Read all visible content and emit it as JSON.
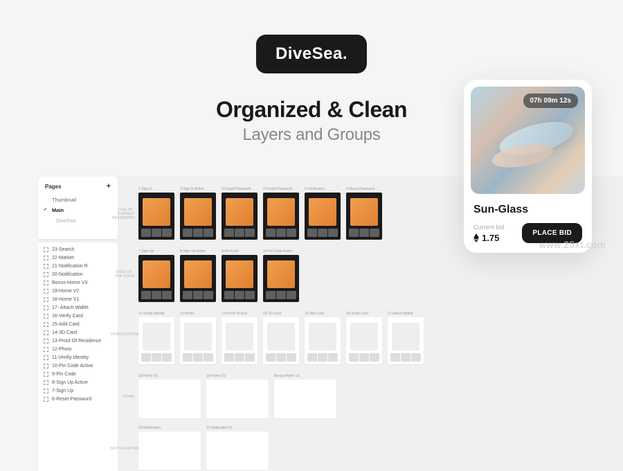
{
  "logo": "DiveSea.",
  "headline": {
    "title": "Organized & Clean",
    "subtitle": "Layers and Groups"
  },
  "pages": {
    "title": "Pages",
    "items": [
      "Thumbnail",
      "Main",
      "DiveSea"
    ],
    "active_index": 1
  },
  "layers": [
    "23-Search",
    "22-Market",
    "21-Notification R",
    "20-Notification",
    "Bonus-Home V3",
    "19-Home V2",
    "18-Home V1",
    "17- Attach Wallet",
    "16-Verify Card",
    "15-Add Card",
    "14-3D Card",
    "13-Proof Of Residence",
    "12-Photo",
    "11-Verifiy Identity",
    "10-Pin Code Active",
    "9-Pin Code",
    "8-Sign Up Active",
    "7-Sign Up",
    "6-Reset Password"
  ],
  "frame_rows": [
    {
      "label": "LOG IN · FORGET PASSWORD",
      "frames": [
        {
          "label": "1-Sign In",
          "style": "dark"
        },
        {
          "label": "2-Sign In Active",
          "style": "dark"
        },
        {
          "label": "3-Forget Password",
          "style": "dark"
        },
        {
          "label": "4-Forget Password",
          "style": "dark"
        },
        {
          "label": "5-Verification",
          "style": "dark"
        },
        {
          "label": "6-Reset Password",
          "style": "dark"
        }
      ]
    },
    {
      "label": "SIGN UP · PIN CODE",
      "frames": [
        {
          "label": "7-Sign Up",
          "style": "dark"
        },
        {
          "label": "8-Sign Up Active",
          "style": "dark"
        },
        {
          "label": "9-Pin Code",
          "style": "dark"
        },
        {
          "label": "10-Pin Code Active",
          "style": "dark"
        }
      ]
    },
    {
      "label": "VERIFICATION",
      "frames": [
        {
          "label": "11-Verifiy Identity",
          "style": "light"
        },
        {
          "label": "12-Photo",
          "style": "light"
        },
        {
          "label": "13-Proof Of Resi",
          "style": "light"
        },
        {
          "label": "14-3D Card",
          "style": "light"
        },
        {
          "label": "15-Add Card",
          "style": "light"
        },
        {
          "label": "16-Verify Card",
          "style": "light"
        },
        {
          "label": "17-Attach Wallet",
          "style": "light"
        }
      ]
    },
    {
      "label": "HOME",
      "frames": [
        {
          "label": "18-Home V1",
          "style": "wide"
        },
        {
          "label": "19-Home V2",
          "style": "wide"
        },
        {
          "label": "Bonus-Home V3",
          "style": "wide"
        }
      ]
    },
    {
      "label": "NOTIFICATION",
      "frames": [
        {
          "label": "20-Notification",
          "style": "wide"
        },
        {
          "label": "21-Notification R",
          "style": "wide"
        }
      ]
    }
  ],
  "nft_card": {
    "timer": "07h 09m 12s",
    "title": "Sun-Glass",
    "bid_label": "Current bid",
    "bid_value": "1.75",
    "button": "PLACE BID"
  },
  "watermark": "www.25xt.com"
}
